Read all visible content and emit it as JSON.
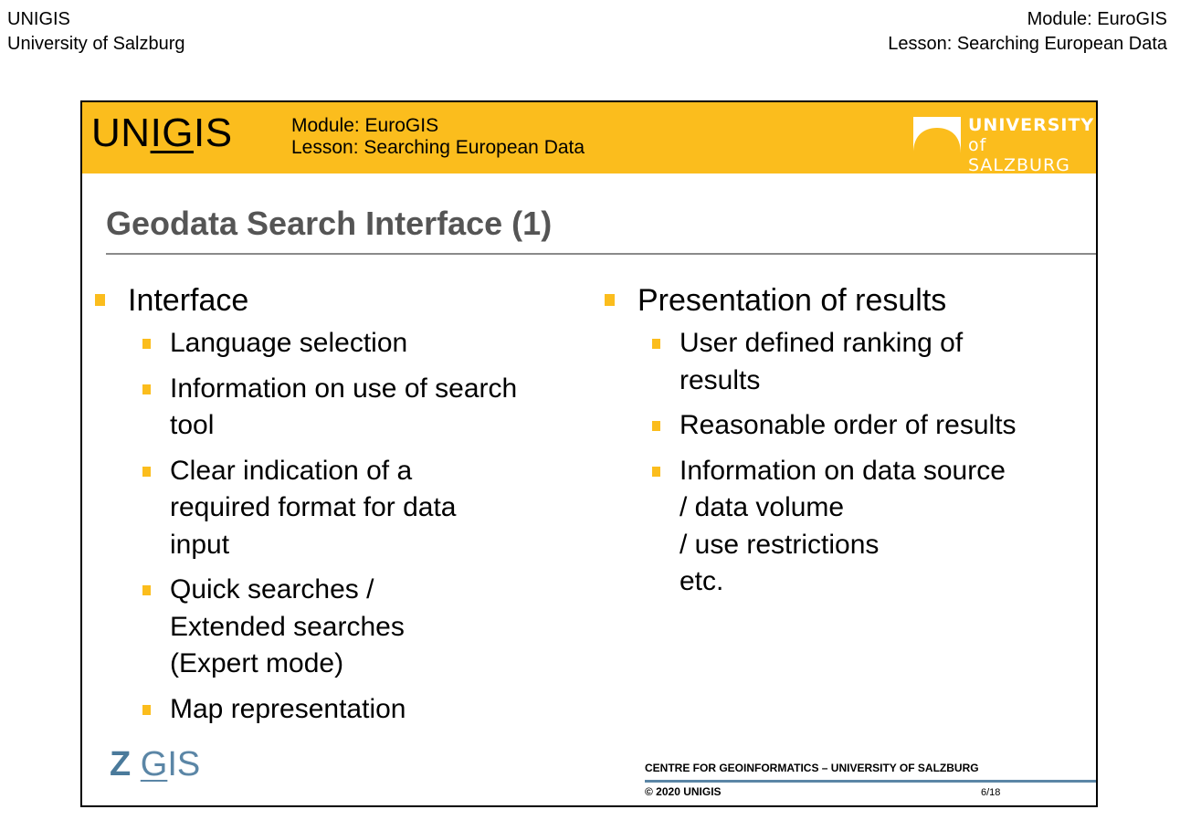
{
  "page_header": {
    "left_line1": "UNIGIS",
    "left_line2": "University of Salzburg",
    "right_line1": "Module: EuroGIS",
    "right_line2": "Lesson: Searching European Data"
  },
  "slide": {
    "banner": {
      "logo_prefix": "UN",
      "logo_underlined": "IG",
      "logo_suffix": "IS",
      "module": "Module: EuroGIS",
      "lesson": "Lesson: Searching European Data",
      "university_line1": "UNIVERSITY",
      "university_line2": "of SALZBURG"
    },
    "title": "Geodata Search Interface (1)",
    "left_column": {
      "heading": "Interface",
      "items": [
        {
          "lines": [
            "Language selection"
          ]
        },
        {
          "lines": [
            "Information on use of search",
            "tool"
          ]
        },
        {
          "lines": [
            "Clear indication of a",
            "required format for data",
            "input"
          ]
        },
        {
          "lines": [
            "Quick searches /",
            "Extended searches",
            "(Expert mode)"
          ]
        },
        {
          "lines": [
            "Map representation"
          ]
        }
      ]
    },
    "right_column": {
      "heading": "Presentation of results",
      "items": [
        {
          "lines": [
            "User defined ranking of",
            "results"
          ]
        },
        {
          "lines": [
            "Reasonable order of results"
          ]
        },
        {
          "lines": [
            "Information on data source",
            "/ data volume",
            "/ use restrictions",
            "etc."
          ]
        }
      ]
    },
    "footer": {
      "zgis_z": "Z",
      "zgis_g": "G",
      "zgis_rest": "IS",
      "centre": "CENTRE FOR GEOINFORMATICS – UNIVERSITY OF SALZBURG",
      "copyright": "© 2020 UNIGIS",
      "page": "6/18"
    },
    "colors": {
      "banner": "#fbbd1d",
      "bullet": "#fbbd1d",
      "title": "#555555",
      "zgis": "#5b86a6"
    }
  }
}
